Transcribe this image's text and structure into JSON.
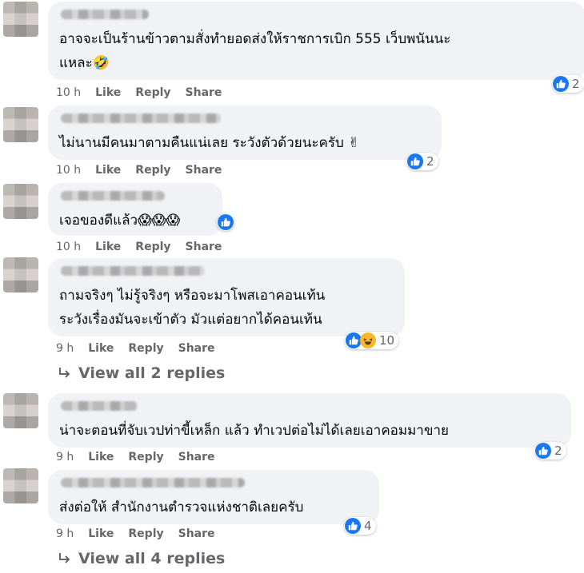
{
  "comments": [
    {
      "text_lines": [
        "อาจจะเป็นร้านข้าวตามสั่งทำยอดส่งให้ราชการเบิก 555 เว็บพนันนะ",
        "แหละ🤣"
      ],
      "time": "10 h",
      "reactions": [
        "like"
      ],
      "reaction_count": "2"
    },
    {
      "text_lines": [
        "ไม่นานมีคนมาตามคืนแน่เลย ระวังตัวด้วยนะครับ ✌"
      ],
      "time": "10 h",
      "reactions": [
        "like"
      ],
      "reaction_count": "2"
    },
    {
      "text_lines": [
        "เจอของดีแล้ว😱😱😱"
      ],
      "time": "10 h",
      "reactions": [
        "like"
      ],
      "reaction_count": ""
    },
    {
      "text_lines": [
        "ถามจริงๆ ไม่รู้จริงๆ หรือจะมาโพสเอาคอนเท้น",
        "ระวังเรื่องมันจะเข้าตัว มัวแต่อยากได้คอนเท้น"
      ],
      "time": "9 h",
      "reactions": [
        "like",
        "haha"
      ],
      "reaction_count": "10",
      "view_replies": "View all 2 replies"
    },
    {
      "text_lines": [
        "น่าจะตอนที่จับเวปท่าขี้เหล็ก แล้ว ทำเวปต่อไม่ได้เลยเอาคอมมาขาย"
      ],
      "time": "9 h",
      "reactions": [
        "like"
      ],
      "reaction_count": "2"
    },
    {
      "text_lines": [
        "ส่งต่อให้ สำนักงานตำรวจแห่งชาติเลยครับ"
      ],
      "time": "9 h",
      "reactions": [
        "like"
      ],
      "reaction_count": "4",
      "view_replies": "View all 4 replies"
    }
  ],
  "actions": {
    "like": "Like",
    "reply": "Reply",
    "share": "Share"
  },
  "icons": {
    "like": "thumbs-up-icon",
    "haha": "laughing-face-icon",
    "reply_arrow": "reply-arrow-icon"
  },
  "colors": {
    "like_blue": "#1877f2",
    "haha_yellow": "#f7b928",
    "bubble": "#f0f2f5",
    "meta_gray": "#65676b"
  }
}
